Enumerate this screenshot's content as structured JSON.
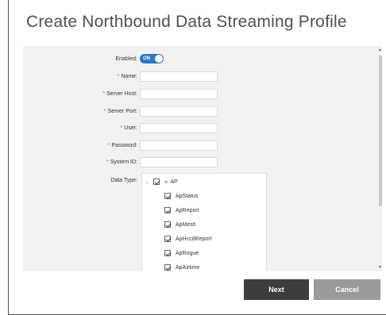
{
  "dialog": {
    "title": "Create Northbound Data Streaming Profile"
  },
  "form": {
    "enabled": {
      "label": "Enabled:",
      "toggle_text": "ON"
    },
    "name": {
      "label": "Name:",
      "value": ""
    },
    "server_host": {
      "label": "Server Host:",
      "value": ""
    },
    "server_port": {
      "label": "Server Port:",
      "value": ""
    },
    "user": {
      "label": "User:",
      "value": ""
    },
    "password": {
      "label": "Password:",
      "value": ""
    },
    "system_id": {
      "label": "System ID:",
      "value": ""
    },
    "data_type": {
      "label": "Data Type:",
      "root": {
        "label": "AP",
        "checked": true
      },
      "items": [
        {
          "label": "ApStatus",
          "checked": true
        },
        {
          "label": "ApReport",
          "checked": true
        },
        {
          "label": "ApMesh",
          "checked": true
        },
        {
          "label": "ApHccdReport",
          "checked": true
        },
        {
          "label": "ApRogue",
          "checked": true
        },
        {
          "label": "ApAirtime",
          "checked": true
        }
      ]
    }
  },
  "buttons": {
    "next": "Next",
    "cancel": "Cancel"
  },
  "colors": {
    "toggle": "#2e77bc",
    "required_marker": "#e8612a",
    "next_button": "#3d3d3d",
    "cancel_button": "#9a9a9a"
  }
}
